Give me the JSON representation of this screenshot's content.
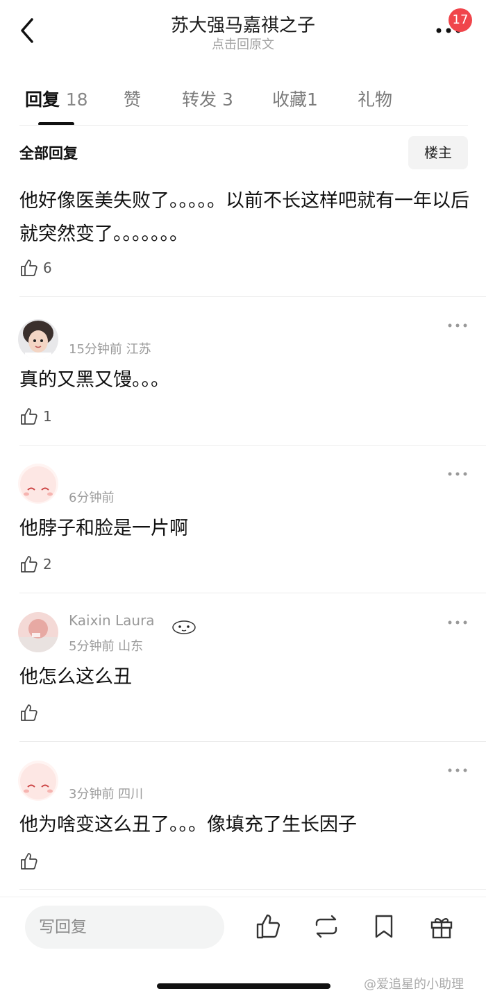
{
  "header": {
    "title": "苏大强马嘉祺之子",
    "subtitle": "点击回原文",
    "back_icon": "chevron-left-icon",
    "more_icon": "more-dots-icon",
    "notification_count": "17"
  },
  "tabs": [
    {
      "label": "回复",
      "count": "18",
      "active": true
    },
    {
      "label": "赞",
      "count": "",
      "active": false
    },
    {
      "label": "转发",
      "count": "3",
      "active": false
    },
    {
      "label": "收藏",
      "count": "1",
      "active": false
    },
    {
      "label": "礼物",
      "count": "",
      "active": false
    }
  ],
  "filter": {
    "label": "全部回复",
    "op_button": "楼主"
  },
  "original_reply": {
    "text": "他好像医美失败了。。。。。以前不长这样吧就有一年以后就突然变了。。。。。。。",
    "likes": "6"
  },
  "comments": [
    {
      "name_fragment": "",
      "meta": "15分钟前 江苏",
      "text": "真的又黑又馒。。。",
      "likes": "1"
    },
    {
      "name_fragment": "",
      "meta": "6分钟前",
      "text": "他脖子和脸是一片啊",
      "likes": "2"
    },
    {
      "name_fragment": "Kaixin Laura",
      "meta": "5分钟前 山东",
      "text": "他怎么这么丑",
      "likes": ""
    },
    {
      "name_fragment": "",
      "meta": "3分钟前 四川",
      "text": "他为啥变这么丑了。。。像填充了生长因子",
      "likes": ""
    }
  ],
  "bottom_bar": {
    "placeholder": "写回复",
    "actions": [
      "like-icon",
      "repost-icon",
      "bookmark-icon",
      "gift-icon"
    ]
  },
  "watermark": "@爱追星的小助理",
  "colors": {
    "badge": "#f0454b",
    "text": "#111111",
    "meta": "#9b9b9b",
    "input_bg": "#f3f4f4"
  }
}
